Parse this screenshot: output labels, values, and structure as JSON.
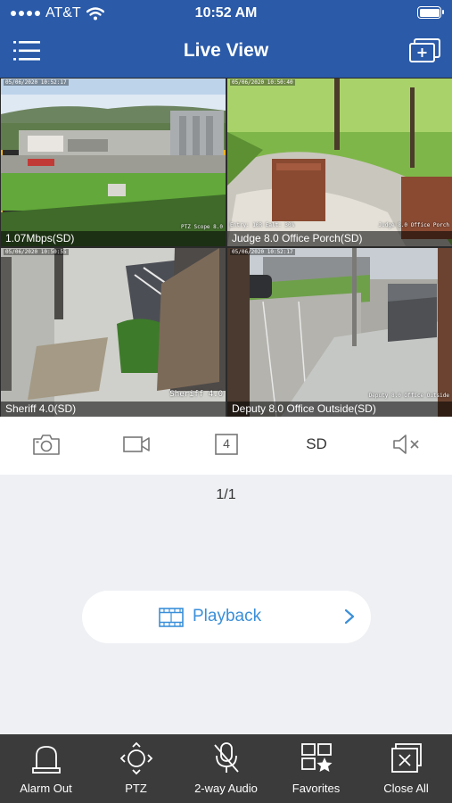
{
  "status_bar": {
    "carrier": "AT&T",
    "time": "10:52 AM"
  },
  "header": {
    "title": "Live View",
    "menu_icon": "hamburger-menu-icon",
    "action_icon": "add-multi-screen-icon"
  },
  "cameras": [
    {
      "label": "1.07Mbps(SD)",
      "timestamp": "05/06/2020 10:52:17",
      "osd": "PTZ Scope 8.0",
      "selected": true
    },
    {
      "label": "Judge 8.0 Office Porch(SD)",
      "timestamp": "05/06/2020 10:50:40",
      "osd": "Judge 8.0 Office Porch",
      "osd2": "Entry: 10R Ealt: 30%"
    },
    {
      "label": "Sheriff 4.0(SD)",
      "timestamp": "05/06/2020 10:50:55",
      "osd": "Sheriff 4.0"
    },
    {
      "label": "Deputy 8.0 Office Outside(SD)",
      "timestamp": "05/06/2020 10:52:17",
      "osd": "Deputy 8.0 Office Outside"
    }
  ],
  "toolbar": {
    "snapshot_icon": "camera-icon",
    "record_icon": "video-record-icon",
    "layout_value": "4",
    "quality_label": "SD",
    "audio_icon": "speaker-muted-icon"
  },
  "pagination": "1/1",
  "playback": {
    "label": "Playback",
    "icon": "film-strip-icon"
  },
  "bottom_nav": [
    {
      "label": "Alarm Out",
      "icon": "alarm-siren-icon"
    },
    {
      "label": "PTZ",
      "icon": "ptz-direction-icon"
    },
    {
      "label": "2-way Audio",
      "icon": "microphone-muted-icon"
    },
    {
      "label": "Favorites",
      "icon": "favorites-star-icon"
    },
    {
      "label": "Close All",
      "icon": "close-all-icon"
    }
  ],
  "colors": {
    "header_bg": "#2a5aa8",
    "accent": "#3a8fd9",
    "selected_border": "#f2b51c",
    "bottom_bar": "#3b3b3b"
  }
}
